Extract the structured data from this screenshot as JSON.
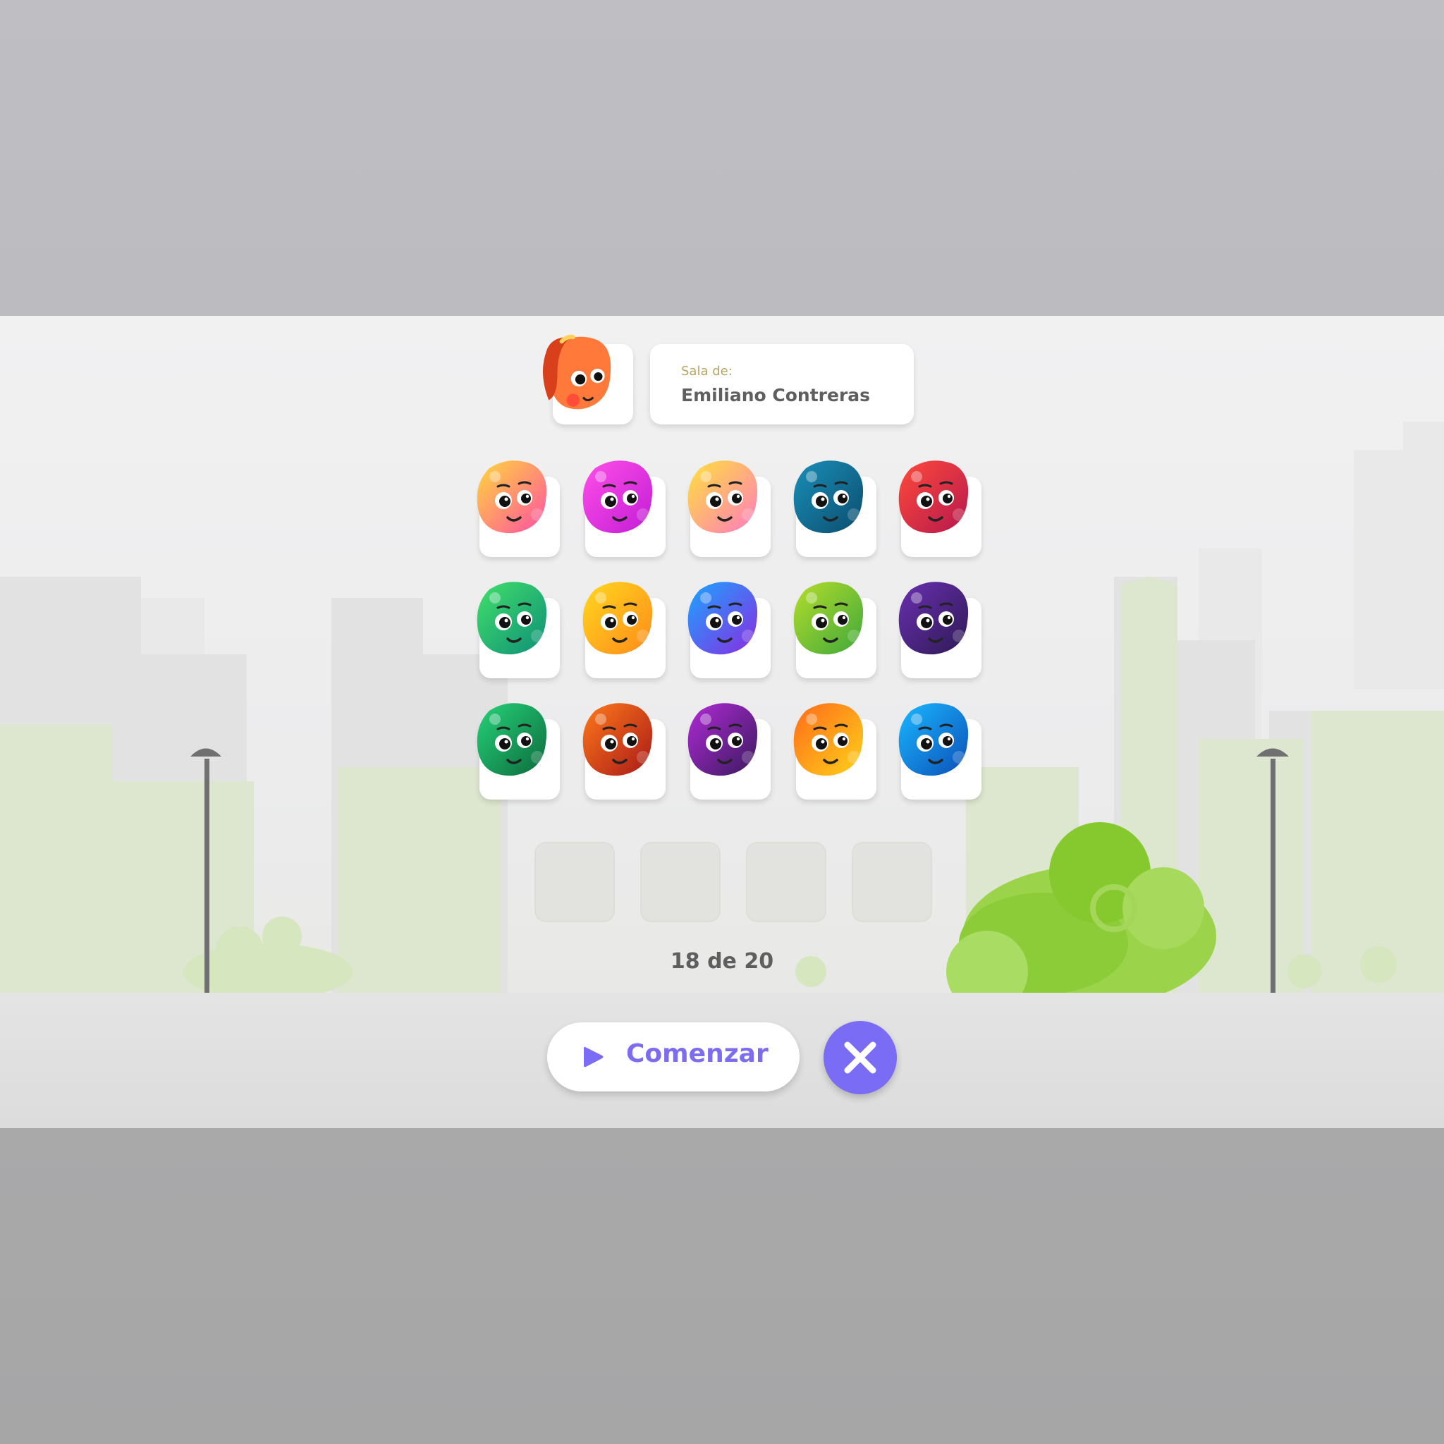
{
  "room": {
    "label": "Sala de:",
    "owner": "Emiliano Contreras"
  },
  "host_avatar": {
    "icon": "orange-blob-avatar",
    "color": "#ff7a3a"
  },
  "players": [
    {
      "icon": "pink-yellow-blob-avatar",
      "c1": "#ffd93a",
      "c2": "#ff4fa3"
    },
    {
      "icon": "magenta-blob-avatar",
      "c1": "#ff4fe8",
      "c2": "#c21dd6"
    },
    {
      "icon": "yellow-pink-blob-avatar",
      "c1": "#ffe23a",
      "c2": "#ff7ac0"
    },
    {
      "icon": "teal-blob-avatar",
      "c1": "#1a8fb8",
      "c2": "#0b4d6e"
    },
    {
      "icon": "red-blob-avatar",
      "c1": "#ff4a3a",
      "c2": "#b5184e"
    },
    {
      "icon": "green-blob-avatar",
      "c1": "#42e06a",
      "c2": "#0e8f78"
    },
    {
      "icon": "yellow-orange-blob-avatar",
      "c1": "#ffd81e",
      "c2": "#ff8a1a"
    },
    {
      "icon": "blue-purple-blob-avatar",
      "c1": "#1aa6ff",
      "c2": "#8a2be2"
    },
    {
      "icon": "lime-blob-avatar",
      "c1": "#b6dd2c",
      "c2": "#3ea83a"
    },
    {
      "icon": "purple-blob-avatar",
      "c1": "#6a2fb0",
      "c2": "#2e1a55"
    },
    {
      "icon": "emerald-blob-avatar",
      "c1": "#26d37a",
      "c2": "#0c6a3c"
    },
    {
      "icon": "red-orange-blob-avatar",
      "c1": "#ff7a1a",
      "c2": "#a81818"
    },
    {
      "icon": "violet-blob-avatar",
      "c1": "#b02ad6",
      "c2": "#3a1a5e"
    },
    {
      "icon": "orange-yellow-blob-avatar",
      "c1": "#ff6a1a",
      "c2": "#ffd21a"
    },
    {
      "icon": "blue-spiky-blob-avatar",
      "c1": "#1ab8ff",
      "c2": "#0b4fb8"
    }
  ],
  "empty_slots": 4,
  "counter": "18 de 20",
  "actions": {
    "start_label": "Comenzar",
    "accent": "#7b6cf5"
  }
}
